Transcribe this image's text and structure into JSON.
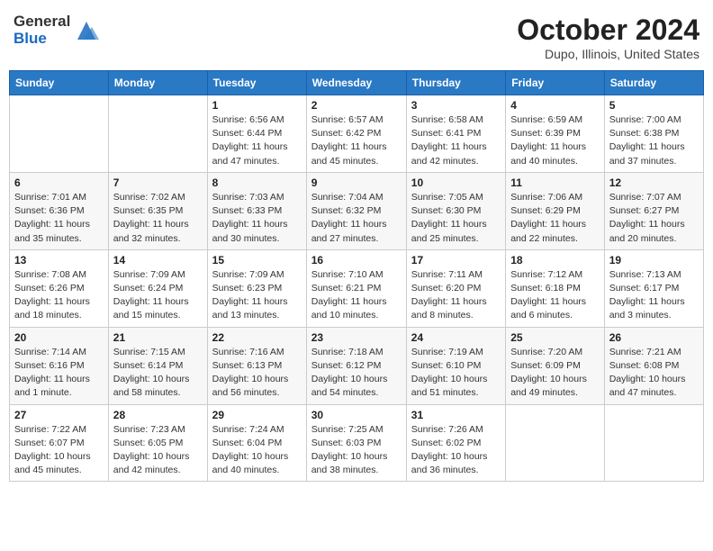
{
  "header": {
    "logo_general": "General",
    "logo_blue": "Blue",
    "title": "October 2024",
    "location": "Dupo, Illinois, United States"
  },
  "days_of_week": [
    "Sunday",
    "Monday",
    "Tuesday",
    "Wednesday",
    "Thursday",
    "Friday",
    "Saturday"
  ],
  "weeks": [
    [
      {
        "day": "",
        "info": ""
      },
      {
        "day": "",
        "info": ""
      },
      {
        "day": "1",
        "info": "Sunrise: 6:56 AM\nSunset: 6:44 PM\nDaylight: 11 hours and 47 minutes."
      },
      {
        "day": "2",
        "info": "Sunrise: 6:57 AM\nSunset: 6:42 PM\nDaylight: 11 hours and 45 minutes."
      },
      {
        "day": "3",
        "info": "Sunrise: 6:58 AM\nSunset: 6:41 PM\nDaylight: 11 hours and 42 minutes."
      },
      {
        "day": "4",
        "info": "Sunrise: 6:59 AM\nSunset: 6:39 PM\nDaylight: 11 hours and 40 minutes."
      },
      {
        "day": "5",
        "info": "Sunrise: 7:00 AM\nSunset: 6:38 PM\nDaylight: 11 hours and 37 minutes."
      }
    ],
    [
      {
        "day": "6",
        "info": "Sunrise: 7:01 AM\nSunset: 6:36 PM\nDaylight: 11 hours and 35 minutes."
      },
      {
        "day": "7",
        "info": "Sunrise: 7:02 AM\nSunset: 6:35 PM\nDaylight: 11 hours and 32 minutes."
      },
      {
        "day": "8",
        "info": "Sunrise: 7:03 AM\nSunset: 6:33 PM\nDaylight: 11 hours and 30 minutes."
      },
      {
        "day": "9",
        "info": "Sunrise: 7:04 AM\nSunset: 6:32 PM\nDaylight: 11 hours and 27 minutes."
      },
      {
        "day": "10",
        "info": "Sunrise: 7:05 AM\nSunset: 6:30 PM\nDaylight: 11 hours and 25 minutes."
      },
      {
        "day": "11",
        "info": "Sunrise: 7:06 AM\nSunset: 6:29 PM\nDaylight: 11 hours and 22 minutes."
      },
      {
        "day": "12",
        "info": "Sunrise: 7:07 AM\nSunset: 6:27 PM\nDaylight: 11 hours and 20 minutes."
      }
    ],
    [
      {
        "day": "13",
        "info": "Sunrise: 7:08 AM\nSunset: 6:26 PM\nDaylight: 11 hours and 18 minutes."
      },
      {
        "day": "14",
        "info": "Sunrise: 7:09 AM\nSunset: 6:24 PM\nDaylight: 11 hours and 15 minutes."
      },
      {
        "day": "15",
        "info": "Sunrise: 7:09 AM\nSunset: 6:23 PM\nDaylight: 11 hours and 13 minutes."
      },
      {
        "day": "16",
        "info": "Sunrise: 7:10 AM\nSunset: 6:21 PM\nDaylight: 11 hours and 10 minutes."
      },
      {
        "day": "17",
        "info": "Sunrise: 7:11 AM\nSunset: 6:20 PM\nDaylight: 11 hours and 8 minutes."
      },
      {
        "day": "18",
        "info": "Sunrise: 7:12 AM\nSunset: 6:18 PM\nDaylight: 11 hours and 6 minutes."
      },
      {
        "day": "19",
        "info": "Sunrise: 7:13 AM\nSunset: 6:17 PM\nDaylight: 11 hours and 3 minutes."
      }
    ],
    [
      {
        "day": "20",
        "info": "Sunrise: 7:14 AM\nSunset: 6:16 PM\nDaylight: 11 hours and 1 minute."
      },
      {
        "day": "21",
        "info": "Sunrise: 7:15 AM\nSunset: 6:14 PM\nDaylight: 10 hours and 58 minutes."
      },
      {
        "day": "22",
        "info": "Sunrise: 7:16 AM\nSunset: 6:13 PM\nDaylight: 10 hours and 56 minutes."
      },
      {
        "day": "23",
        "info": "Sunrise: 7:18 AM\nSunset: 6:12 PM\nDaylight: 10 hours and 54 minutes."
      },
      {
        "day": "24",
        "info": "Sunrise: 7:19 AM\nSunset: 6:10 PM\nDaylight: 10 hours and 51 minutes."
      },
      {
        "day": "25",
        "info": "Sunrise: 7:20 AM\nSunset: 6:09 PM\nDaylight: 10 hours and 49 minutes."
      },
      {
        "day": "26",
        "info": "Sunrise: 7:21 AM\nSunset: 6:08 PM\nDaylight: 10 hours and 47 minutes."
      }
    ],
    [
      {
        "day": "27",
        "info": "Sunrise: 7:22 AM\nSunset: 6:07 PM\nDaylight: 10 hours and 45 minutes."
      },
      {
        "day": "28",
        "info": "Sunrise: 7:23 AM\nSunset: 6:05 PM\nDaylight: 10 hours and 42 minutes."
      },
      {
        "day": "29",
        "info": "Sunrise: 7:24 AM\nSunset: 6:04 PM\nDaylight: 10 hours and 40 minutes."
      },
      {
        "day": "30",
        "info": "Sunrise: 7:25 AM\nSunset: 6:03 PM\nDaylight: 10 hours and 38 minutes."
      },
      {
        "day": "31",
        "info": "Sunrise: 7:26 AM\nSunset: 6:02 PM\nDaylight: 10 hours and 36 minutes."
      },
      {
        "day": "",
        "info": ""
      },
      {
        "day": "",
        "info": ""
      }
    ]
  ]
}
